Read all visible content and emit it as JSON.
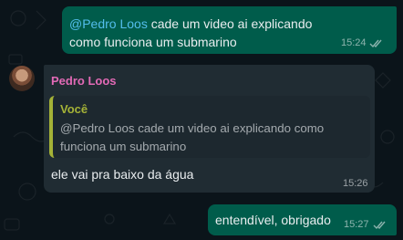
{
  "messages": {
    "outgoing_1": {
      "mention": "@Pedro Loos",
      "text": " cade um video ai explicando como funciona um submarino",
      "time": "15:24",
      "status_icon": "double-check-icon"
    },
    "incoming_1": {
      "sender": "Pedro Loos",
      "avatar_icon": "avatar",
      "quote_author": "Você",
      "quote_text": "@Pedro Loos cade um video ai explicando como funciona um submarino",
      "text": "ele vai pra baixo da água",
      "time": "15:26"
    },
    "outgoing_2": {
      "text": "entendível, obrigado",
      "time": "15:27",
      "status_icon": "double-check-icon"
    }
  },
  "colors": {
    "background": "#0b141a",
    "outgoing_bubble": "#005c4b",
    "incoming_bubble": "#202c33",
    "mention": "#53bdeb",
    "sender_name": "#e26ab6",
    "quote_accent": "#a5b337"
  }
}
